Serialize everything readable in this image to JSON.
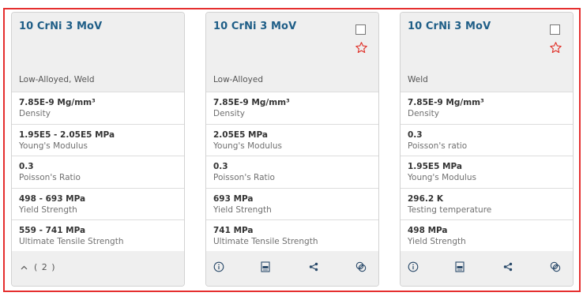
{
  "colors": {
    "selection_border": "#e52f2f",
    "title": "#1f5e87",
    "star": "#e0332b"
  },
  "cards": [
    {
      "title": "10 CrNi 3 MoV",
      "subtitle": "Low-Alloyed, Weld",
      "properties": [
        {
          "value": "7.85E-9 Mg/mm³",
          "label": "Density"
        },
        {
          "value": "1.95E5 - 2.05E5 MPa",
          "label": "Young's Modulus"
        },
        {
          "value": "0.3",
          "label": "Poisson's Ratio"
        },
        {
          "value": "498 - 693 MPa",
          "label": "Yield Strength"
        },
        {
          "value": "559 - 741 MPa",
          "label": "Ultimate Tensile Strength"
        }
      ],
      "footer": {
        "expand_icon": "chevron-up-icon",
        "count": "( 2 )"
      }
    },
    {
      "title": "10 CrNi 3 MoV",
      "subtitle": "Low-Alloyed",
      "properties": [
        {
          "value": "7.85E-9 Mg/mm³",
          "label": "Density"
        },
        {
          "value": "2.05E5 MPa",
          "label": "Young's Modulus"
        },
        {
          "value": "0.3",
          "label": "Poisson's Ratio"
        },
        {
          "value": "693 MPa",
          "label": "Yield Strength"
        },
        {
          "value": "741 MPa",
          "label": "Ultimate Tensile Strength"
        }
      ],
      "footer": {
        "icons": [
          "info-icon",
          "pdf-icon",
          "share-icon",
          "compare-icon"
        ]
      }
    },
    {
      "title": "10 CrNi 3 MoV",
      "subtitle": "Weld",
      "properties": [
        {
          "value": "7.85E-9 Mg/mm³",
          "label": "Density"
        },
        {
          "value": "0.3",
          "label": "Poisson's ratio"
        },
        {
          "value": "1.95E5 MPa",
          "label": "Young's Modulus"
        },
        {
          "value": "296.2 K",
          "label": "Testing temperature"
        },
        {
          "value": "498 MPa",
          "label": "Yield Strength"
        }
      ],
      "footer": {
        "icons": [
          "info-icon",
          "pdf-icon",
          "share-icon",
          "compare-icon"
        ]
      }
    }
  ]
}
